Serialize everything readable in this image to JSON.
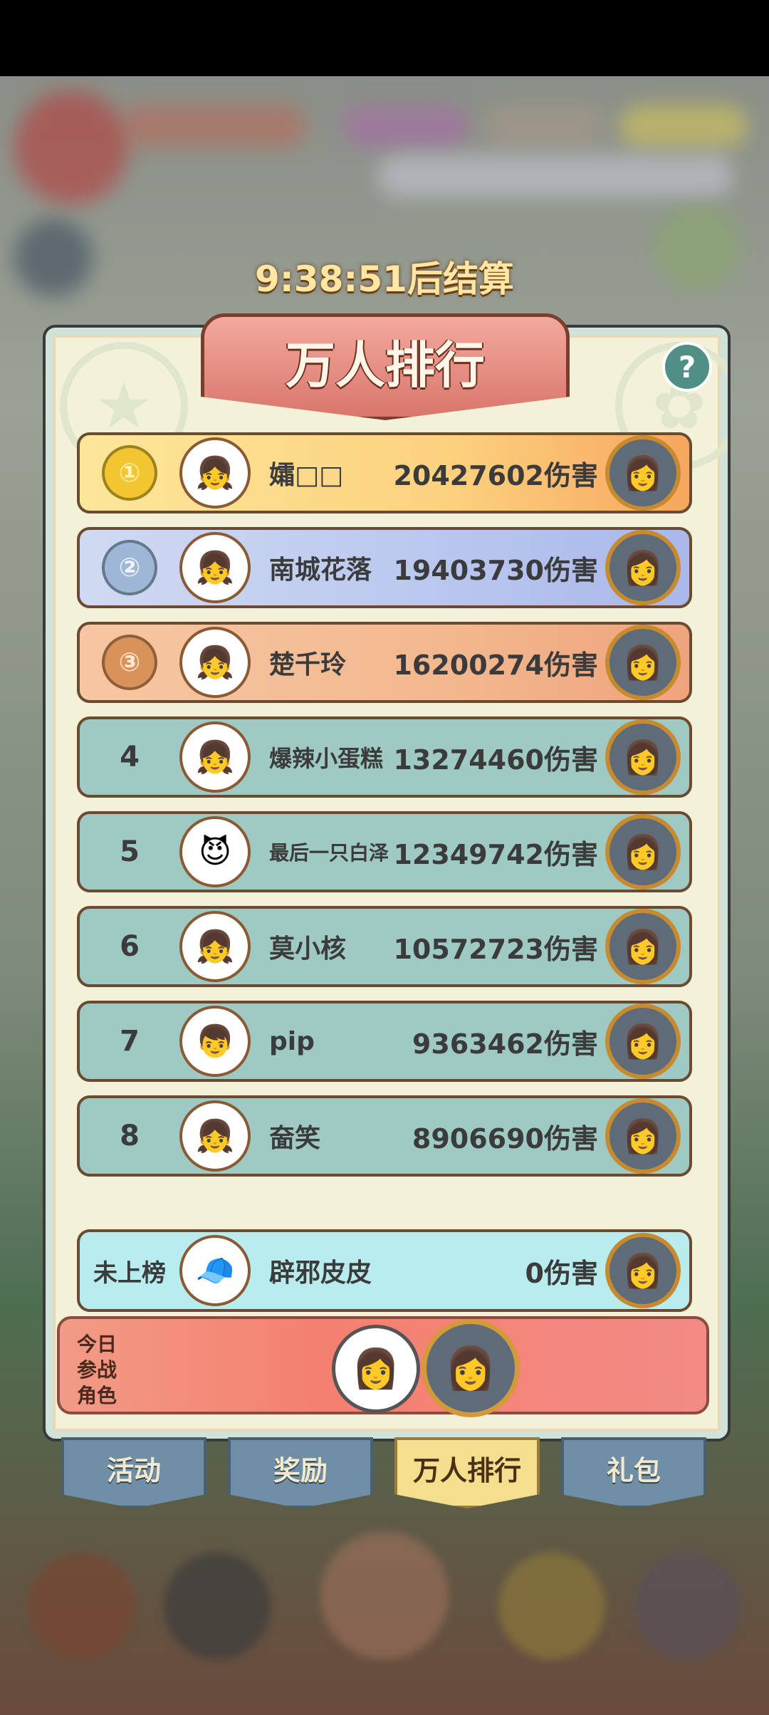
{
  "timer": "9:38:51后结算",
  "title": "万人排行",
  "help_icon": "?",
  "ranking": [
    {
      "rank": "①",
      "name": "孀□□",
      "score": "20427602伤害",
      "avatar": "silver-hair-girl-icon",
      "partner": "dark-hair-girl-icon"
    },
    {
      "rank": "②",
      "name": "南城花落",
      "score": "19403730伤害",
      "avatar": "silver-hair-girl-icon",
      "partner": "dark-hair-girl-icon"
    },
    {
      "rank": "③",
      "name": "楚千玲",
      "score": "16200274伤害",
      "avatar": "silver-hair-girl-icon",
      "partner": "dark-hair-girl-icon"
    },
    {
      "rank": "4",
      "name": "爆辣小蛋糕",
      "score": "13274460伤害",
      "avatar": "silver-hair-girl-icon",
      "partner": "dark-hair-girl-icon"
    },
    {
      "rank": "5",
      "name": "最后一只白泽",
      "score": "12349742伤害",
      "avatar": "horned-girl-icon",
      "partner": "dark-hair-girl-icon"
    },
    {
      "rank": "6",
      "name": "莫小核",
      "score": "10572723伤害",
      "avatar": "silver-hair-girl-icon",
      "partner": "dark-hair-girl-icon"
    },
    {
      "rank": "7",
      "name": "pip",
      "score": "9363462伤害",
      "avatar": "blond-boy-icon",
      "partner": "dark-hair-girl-icon"
    },
    {
      "rank": "8",
      "name": "奤笑",
      "score": "8906690伤害",
      "avatar": "red-flower-girl-icon",
      "partner": "dark-hair-girl-icon"
    }
  ],
  "my_entry": {
    "rank": "未上榜",
    "name": "辟邪皮皮",
    "score": "0伤害",
    "avatar": "red-cap-boy-icon",
    "partner": "dark-hair-girl-icon"
  },
  "today": {
    "label": "今日参战角色",
    "c1": "white-hair-girl-icon",
    "c2": "dark-hair-girl-icon"
  },
  "tabs": [
    "活动",
    "奖励",
    "万人排行",
    "礼包"
  ],
  "colors": {
    "gold": "#f2c531",
    "silver": "#9fb7d7",
    "bronze": "#d9935a",
    "teal": "#9fcac4"
  }
}
